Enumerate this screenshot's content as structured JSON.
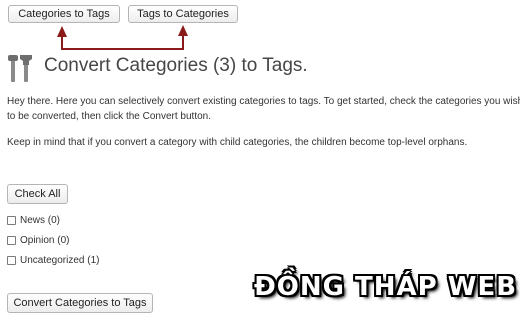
{
  "toolbar": {
    "categories_to_tags_label": "Categories to Tags",
    "tags_to_categories_label": "Tags to Categories",
    "arrow_color": "#8b1a1a"
  },
  "page": {
    "title": "Convert Categories (3) to Tags.",
    "intro_text": "Hey there. Here you can selectively convert existing categories to tags. To get started, check the categories you wish to be converted, then click the Convert button.",
    "orphans_text": "Keep in mind that if you convert a category with child categories, the children become top-level orphans.",
    "check_all_label": "Check All",
    "convert_label": "Convert Categories to Tags"
  },
  "categories": [
    {
      "label": "News (0)",
      "checked": false
    },
    {
      "label": "Opinion (0)",
      "checked": false
    },
    {
      "label": "Uncategorized (1)",
      "checked": false
    }
  ],
  "icons": {
    "title_icon": "tools-icon"
  },
  "watermark": {
    "text": "ĐỒNG THÁP WEB"
  }
}
